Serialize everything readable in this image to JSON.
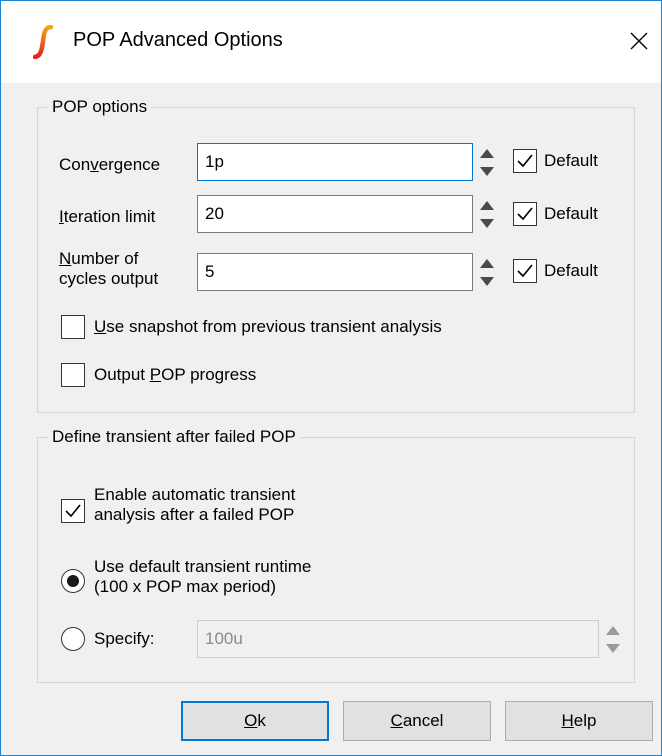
{
  "window": {
    "title": "POP Advanced Options"
  },
  "pop_options": {
    "legend": "POP options",
    "convergence": {
      "label_pre": "Con",
      "label_accel": "v",
      "label_post": "ergence",
      "value": "1p",
      "default_label": "Default",
      "default_checked": true
    },
    "iteration_limit": {
      "label_accel": "I",
      "label_post": "teration limit",
      "value": "20",
      "default_label": "Default",
      "default_checked": true
    },
    "cycles_output": {
      "label_line1_accel": "N",
      "label_line1_post": "umber of",
      "label_line2": "cycles output",
      "value": "5",
      "default_label": "Default",
      "default_checked": true
    },
    "snapshot": {
      "label_accel": "U",
      "label_post": "se snapshot from previous transient analysis",
      "checked": false
    },
    "progress": {
      "label_pre": "Output ",
      "label_accel": "P",
      "label_post": "OP progress",
      "checked": false
    }
  },
  "transient": {
    "legend": "Define transient after failed POP",
    "enable": {
      "line1": "Enable automatic transient",
      "line2": "analysis after a failed POP",
      "checked": true
    },
    "default_runtime": {
      "line1": "Use default transient runtime",
      "line2": "(100 x POP max period)",
      "selected": true
    },
    "specify": {
      "label": "Specify:",
      "value": "100u",
      "selected": false
    }
  },
  "buttons": {
    "ok": {
      "accel": "O",
      "rest": "k"
    },
    "cancel": {
      "accel": "C",
      "rest": "ancel"
    },
    "help": {
      "accel": "H",
      "rest": "elp"
    }
  },
  "colors": {
    "accent": "#0078d7",
    "window_border": "#1883d7",
    "icon_red": "#e8201c",
    "icon_orange": "#f7a21b"
  }
}
